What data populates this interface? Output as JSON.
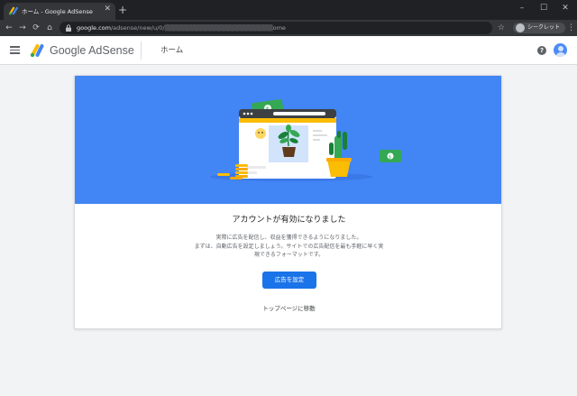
{
  "browser": {
    "tab_title": "ホーム - Google AdSense",
    "tab_close": "✕",
    "new_tab": "+",
    "window_controls": [
      "–",
      "☐",
      "✕"
    ],
    "nav": {
      "back": "←",
      "forward": "→",
      "reload": "⟳",
      "home": "⌂"
    },
    "url": {
      "host": "google.com",
      "path": "/adsense/new/u/0/",
      "redacted": "▒▒▒▒▒▒▒▒▒▒▒▒▒▒▒▒▒▒▒▒▒▒▒▒",
      "suffix": "ome"
    },
    "incognito_label": "シークレット",
    "menu": "⋮",
    "bookmark": "☆"
  },
  "header": {
    "product_name": "Google AdSense",
    "page_title": "ホーム",
    "help": "?"
  },
  "card": {
    "title": "アカウントが有効になりました",
    "description_lines": [
      "実際に広告を配信し、収益を獲得できるようになりました。",
      "まずは、自動広告を設定しましょう。サイトでの広告配信を最も手軽に早く実",
      "現できるフォーマットです。"
    ],
    "primary_button": "広告を設定",
    "secondary_link": "トップページに移動"
  },
  "icons": {
    "menu": "hamburger-icon",
    "help": "help-icon",
    "account": "account-avatar-icon",
    "logo": "adsense-logo"
  },
  "colors": {
    "hero_bg": "#4285f4",
    "primary": "#1a73e8",
    "logo_yellow": "#fbbc04",
    "logo_blue": "#4285f4",
    "logo_green": "#34a853"
  }
}
